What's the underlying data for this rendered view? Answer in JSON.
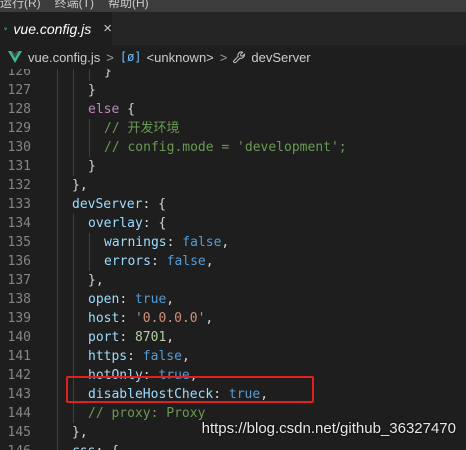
{
  "menubar": {
    "items": [
      "运行(R)",
      "终端(T)",
      "帮助(H)"
    ]
  },
  "tab": {
    "label": "vue.config.js",
    "close": "×"
  },
  "breadcrumb": {
    "file": "vue.config.js",
    "scope": "<unknown>",
    "symbol": "devServer",
    "separator": ">"
  },
  "editor": {
    "lines": [
      {
        "n": "126",
        "indent": 2,
        "tokens": [
          {
            "t": "}",
            "c": "plain"
          }
        ]
      },
      {
        "n": "127",
        "indent": 1,
        "tokens": [
          {
            "t": "}",
            "c": "plain"
          }
        ]
      },
      {
        "n": "128",
        "indent": 1,
        "tokens": [
          {
            "t": "else",
            "c": "keyword"
          },
          {
            "t": " {",
            "c": "plain"
          }
        ]
      },
      {
        "n": "129",
        "indent": 2,
        "tokens": [
          {
            "t": "// 开发环境",
            "c": "comment"
          }
        ]
      },
      {
        "n": "130",
        "indent": 2,
        "tokens": [
          {
            "t": "// config.mode = 'development';",
            "c": "comment"
          }
        ]
      },
      {
        "n": "131",
        "indent": 1,
        "tokens": [
          {
            "t": "}",
            "c": "plain"
          }
        ]
      },
      {
        "n": "132",
        "indent": 0,
        "tokens": [
          {
            "t": "},",
            "c": "plain"
          }
        ]
      },
      {
        "n": "133",
        "indent": 0,
        "tokens": [
          {
            "t": "devServer",
            "c": "prop"
          },
          {
            "t": ": {",
            "c": "plain"
          }
        ]
      },
      {
        "n": "134",
        "indent": 1,
        "tokens": [
          {
            "t": "overlay",
            "c": "prop"
          },
          {
            "t": ": {",
            "c": "plain"
          }
        ]
      },
      {
        "n": "135",
        "indent": 2,
        "tokens": [
          {
            "t": "warnings",
            "c": "prop"
          },
          {
            "t": ": ",
            "c": "plain"
          },
          {
            "t": "false",
            "c": "bool"
          },
          {
            "t": ",",
            "c": "plain"
          }
        ]
      },
      {
        "n": "136",
        "indent": 2,
        "tokens": [
          {
            "t": "errors",
            "c": "prop"
          },
          {
            "t": ": ",
            "c": "plain"
          },
          {
            "t": "false",
            "c": "bool"
          },
          {
            "t": ",",
            "c": "plain"
          }
        ]
      },
      {
        "n": "137",
        "indent": 1,
        "tokens": [
          {
            "t": "},",
            "c": "plain"
          }
        ]
      },
      {
        "n": "138",
        "indent": 1,
        "tokens": [
          {
            "t": "open",
            "c": "prop"
          },
          {
            "t": ": ",
            "c": "plain"
          },
          {
            "t": "true",
            "c": "bool"
          },
          {
            "t": ",",
            "c": "plain"
          }
        ]
      },
      {
        "n": "139",
        "indent": 1,
        "tokens": [
          {
            "t": "host",
            "c": "prop"
          },
          {
            "t": ": ",
            "c": "plain"
          },
          {
            "t": "'0.0.0.0'",
            "c": "string"
          },
          {
            "t": ",",
            "c": "plain"
          }
        ]
      },
      {
        "n": "140",
        "indent": 1,
        "tokens": [
          {
            "t": "port",
            "c": "prop"
          },
          {
            "t": ": ",
            "c": "plain"
          },
          {
            "t": "8701",
            "c": "num"
          },
          {
            "t": ",",
            "c": "plain"
          }
        ]
      },
      {
        "n": "141",
        "indent": 1,
        "tokens": [
          {
            "t": "https",
            "c": "prop"
          },
          {
            "t": ": ",
            "c": "plain"
          },
          {
            "t": "false",
            "c": "bool"
          },
          {
            "t": ",",
            "c": "plain"
          }
        ]
      },
      {
        "n": "142",
        "indent": 1,
        "tokens": [
          {
            "t": "hotOnly",
            "c": "prop"
          },
          {
            "t": ": ",
            "c": "plain"
          },
          {
            "t": "true",
            "c": "bool"
          },
          {
            "t": ",",
            "c": "plain"
          }
        ]
      },
      {
        "n": "143",
        "indent": 1,
        "tokens": [
          {
            "t": "disableHostCheck",
            "c": "prop"
          },
          {
            "t": ": ",
            "c": "plain"
          },
          {
            "t": "true",
            "c": "bool"
          },
          {
            "t": ",",
            "c": "plain"
          }
        ]
      },
      {
        "n": "144",
        "indent": 1,
        "tokens": [
          {
            "t": "// proxy: Proxy",
            "c": "comment"
          }
        ]
      },
      {
        "n": "145",
        "indent": 0,
        "tokens": [
          {
            "t": "},",
            "c": "plain"
          }
        ]
      },
      {
        "n": "146",
        "indent": 0,
        "tokens": [
          {
            "t": "css",
            "c": "prop"
          },
          {
            "t": ": {",
            "c": "plain"
          }
        ]
      }
    ]
  },
  "watermark": "https://blog.csdn.net/github_36327470",
  "colors": {
    "background": "#1e1e1e",
    "highlight_box": "#e0201b",
    "vue_green": "#41b883"
  }
}
